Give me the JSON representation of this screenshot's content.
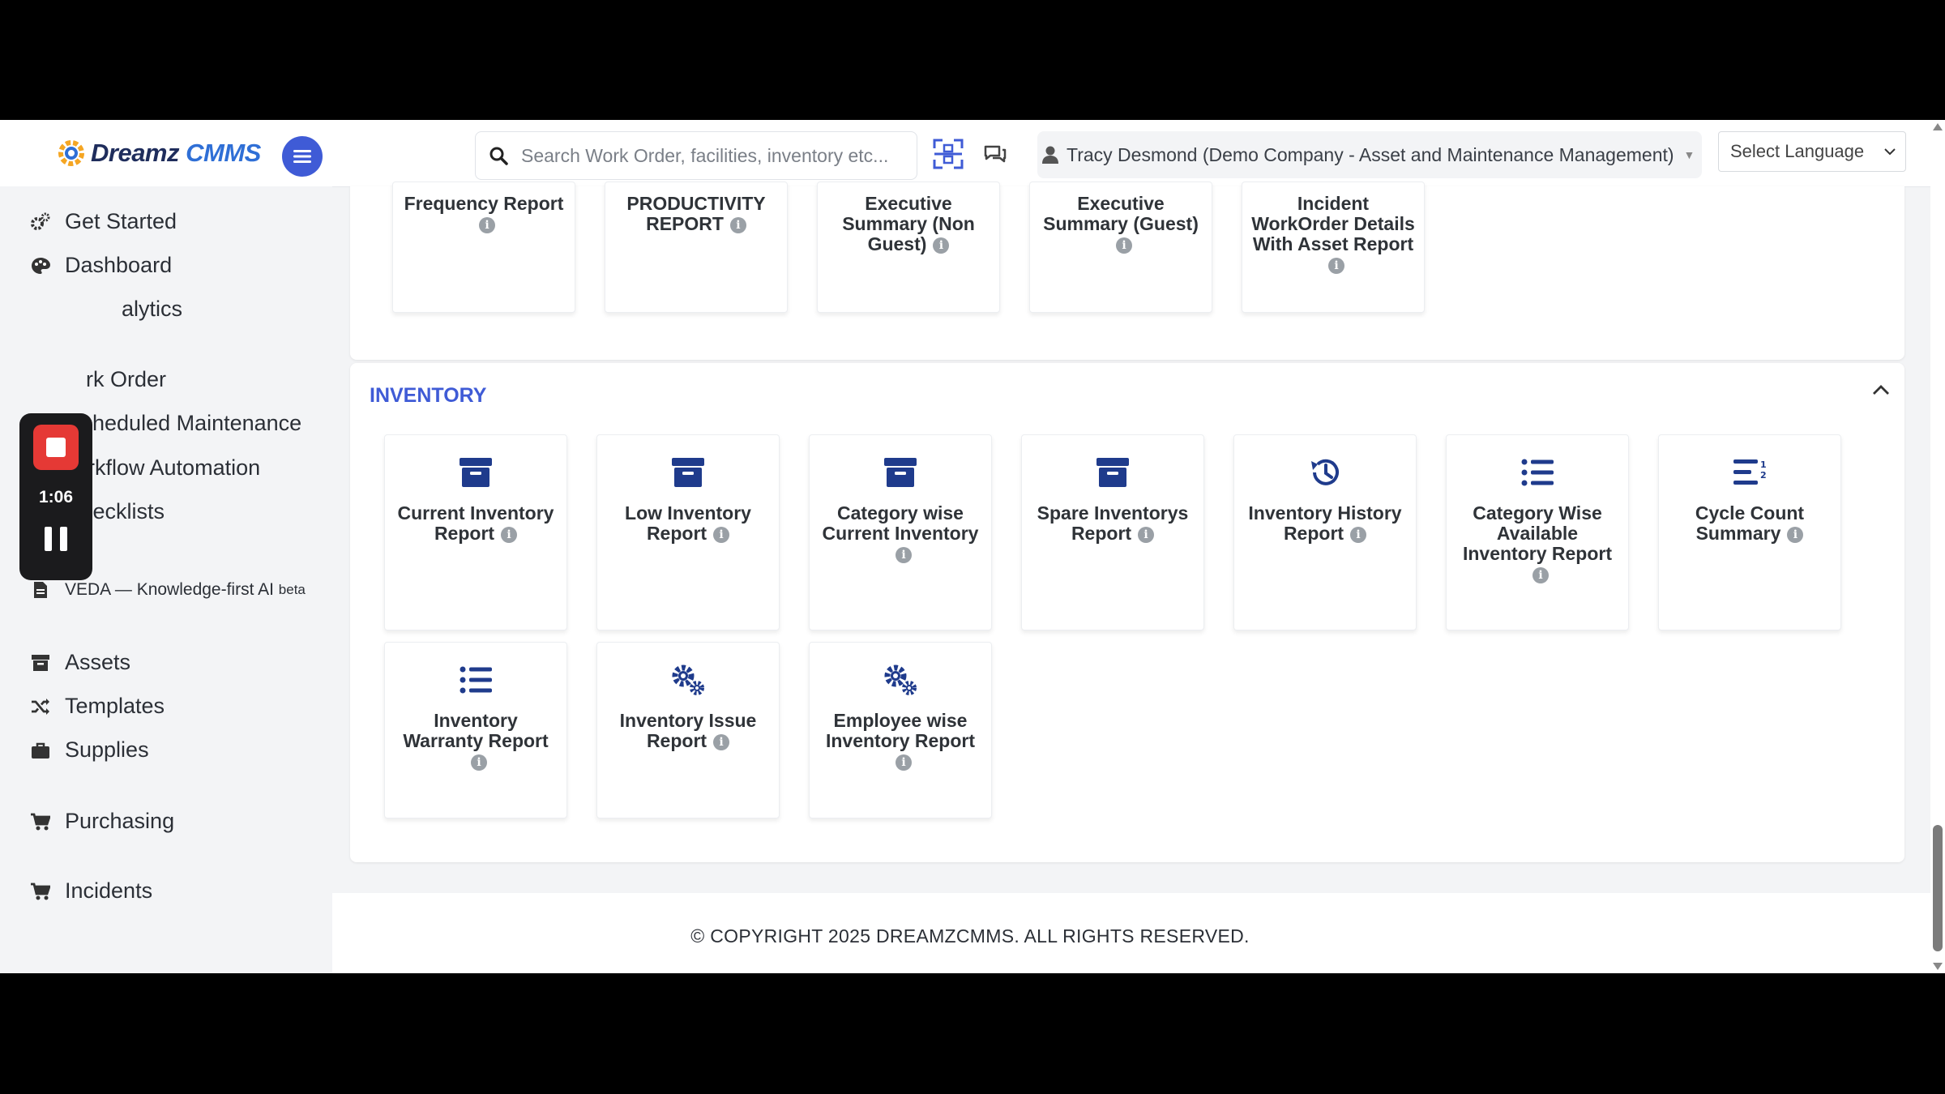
{
  "header": {
    "logo_main": "Dreamz",
    "logo_accent": "CMMS",
    "search_placeholder": "Search Work Order, facilities, inventory etc...",
    "user": "Tracy Desmond (Demo Company - Asset and Maintenance Management)",
    "language": "Select Language"
  },
  "sidebar": {
    "items": [
      {
        "label": "Get Started",
        "icon": "gears-icon"
      },
      {
        "label": "Dashboard",
        "icon": "palette-icon"
      },
      {
        "label": "alytics",
        "icon": "analytics-icon"
      },
      {
        "label": "rk Order",
        "icon": "work-order-icon"
      },
      {
        "label": "heduled Maintenance",
        "icon": "calendar-icon"
      },
      {
        "label": "Workflow Automation",
        "icon": "branch-icon"
      },
      {
        "label": "Checklists",
        "icon": "checkbox-icon"
      },
      {
        "label": "VEDA — Knowledge-first AI",
        "badge": "beta",
        "icon": "document-icon"
      },
      {
        "label": "Assets",
        "icon": "archive-icon"
      },
      {
        "label": "Templates",
        "icon": "shuffle-icon"
      },
      {
        "label": "Supplies",
        "icon": "briefcase-icon"
      },
      {
        "label": "Purchasing",
        "icon": "cart-icon"
      },
      {
        "label": "Incidents",
        "icon": "cart-icon"
      }
    ]
  },
  "recorder": {
    "time": "1:06"
  },
  "top_cards": [
    {
      "title": "Frequency Report"
    },
    {
      "title": "PRODUCTIVITY REPORT"
    },
    {
      "title": "Executive Summary (Non Guest)"
    },
    {
      "title": "Executive Summary (Guest)"
    },
    {
      "title": "Incident WorkOrder Details With Asset Report"
    }
  ],
  "inventory": {
    "title": "INVENTORY",
    "cards": [
      {
        "title": "Current Inventory Report",
        "icon": "archive-box-icon"
      },
      {
        "title": "Low Inventory Report",
        "icon": "archive-box-icon"
      },
      {
        "title": "Category wise Current Inventory",
        "icon": "archive-box-icon"
      },
      {
        "title": "Spare Inventorys Report",
        "icon": "archive-box-icon"
      },
      {
        "title": "Inventory History Report",
        "icon": "history-icon"
      },
      {
        "title": "Category Wise Available Inventory Report",
        "icon": "list-icon"
      },
      {
        "title": "Cycle Count Summary",
        "icon": "sort-list-icon"
      },
      {
        "title": "Inventory Warranty Report",
        "icon": "list-icon"
      },
      {
        "title": "Inventory Issue Report",
        "icon": "cogs-icon"
      },
      {
        "title": "Employee wise Inventory Report",
        "icon": "cogs-icon"
      }
    ]
  },
  "footer": {
    "copyright": "© COPYRIGHT 2025 DREAMZCMMS. ALL RIGHTS RESERVED."
  },
  "colors": {
    "accent": "#3f5bd6",
    "icon_navy": "#1f3b8c",
    "recorder_red": "#e53935"
  }
}
